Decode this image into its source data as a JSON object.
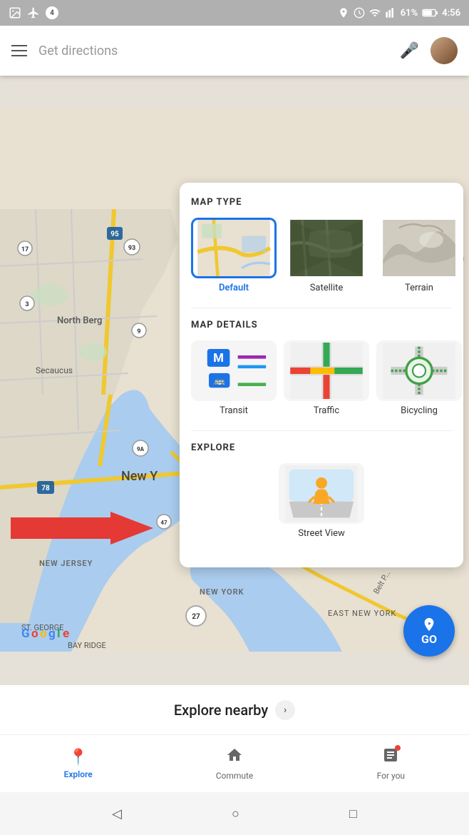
{
  "statusBar": {
    "notifications": "4",
    "airplane": "✈",
    "battery": "61%",
    "time": "4:56",
    "signal": "▲▲▲▲"
  },
  "searchBar": {
    "placeholder": "Get directions",
    "micIcon": "🎤"
  },
  "mapPanel": {
    "mapTypeTitle": "MAP TYPE",
    "mapDetailsTitle": "MAP DETAILS",
    "exploreTitle": "EXPLORE",
    "mapTypes": [
      {
        "id": "default",
        "label": "Default",
        "selected": true
      },
      {
        "id": "satellite",
        "label": "Satellite",
        "selected": false
      },
      {
        "id": "terrain",
        "label": "Terrain",
        "selected": false
      }
    ],
    "mapDetails": [
      {
        "id": "transit",
        "label": "Transit"
      },
      {
        "id": "traffic",
        "label": "Traffic"
      },
      {
        "id": "bicycling",
        "label": "Bicycling"
      }
    ],
    "exploreItems": [
      {
        "id": "streetview",
        "label": "Street View"
      }
    ]
  },
  "goButton": {
    "label": "GO"
  },
  "bottomSection": {
    "exploreNearby": "Explore nearby",
    "chevron": "›"
  },
  "bottomNav": [
    {
      "id": "explore",
      "icon": "📍",
      "label": "Explore",
      "active": true
    },
    {
      "id": "commute",
      "icon": "🏢",
      "label": "Commute",
      "active": false
    },
    {
      "id": "foryou",
      "icon": "✨",
      "label": "For you",
      "active": false,
      "notification": true
    }
  ],
  "systemNav": {
    "back": "◁",
    "home": "○",
    "recent": "□"
  },
  "mapLabels": {
    "northBergen": "North Berg",
    "newYork": "New Y",
    "secaucus": "Secaucus",
    "newJersey": "NEW JERSEY",
    "newYorkState": "NEW YORK",
    "stGeorge": "ST. GEORGE",
    "bayRidge": "BAY RIDGE",
    "eastNewYork": "EAST NEW YORK",
    "google": "Google",
    "route27": "27"
  }
}
